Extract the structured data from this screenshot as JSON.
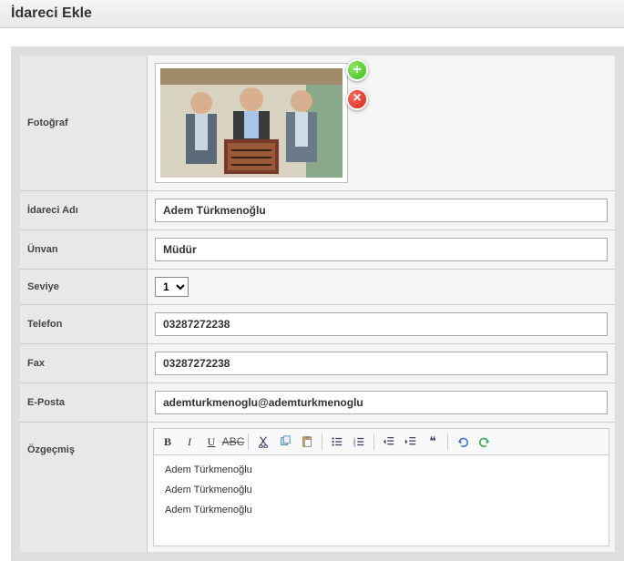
{
  "header": {
    "title": "İdareci Ekle"
  },
  "labels": {
    "photo": "Fotoğraf",
    "name": "İdareci Adı",
    "title_": "Ünvan",
    "level": "Seviye",
    "phone": "Telefon",
    "fax": "Fax",
    "email": "E-Posta",
    "bio": "Özgeçmiş"
  },
  "values": {
    "name": "Adem Türkmenoğlu",
    "title_": "Müdür",
    "level": "1",
    "phone": "03287272238",
    "fax": "03287272238",
    "email": "ademturkmenoglu@ademturkmenoglu"
  },
  "bio_lines": {
    "l0": "Adem Türkmenoğlu",
    "l1": "Adem Türkmenoğlu",
    "l2": "Adem Türkmenoğlu"
  },
  "icons": {
    "add": "+",
    "remove": "×"
  }
}
